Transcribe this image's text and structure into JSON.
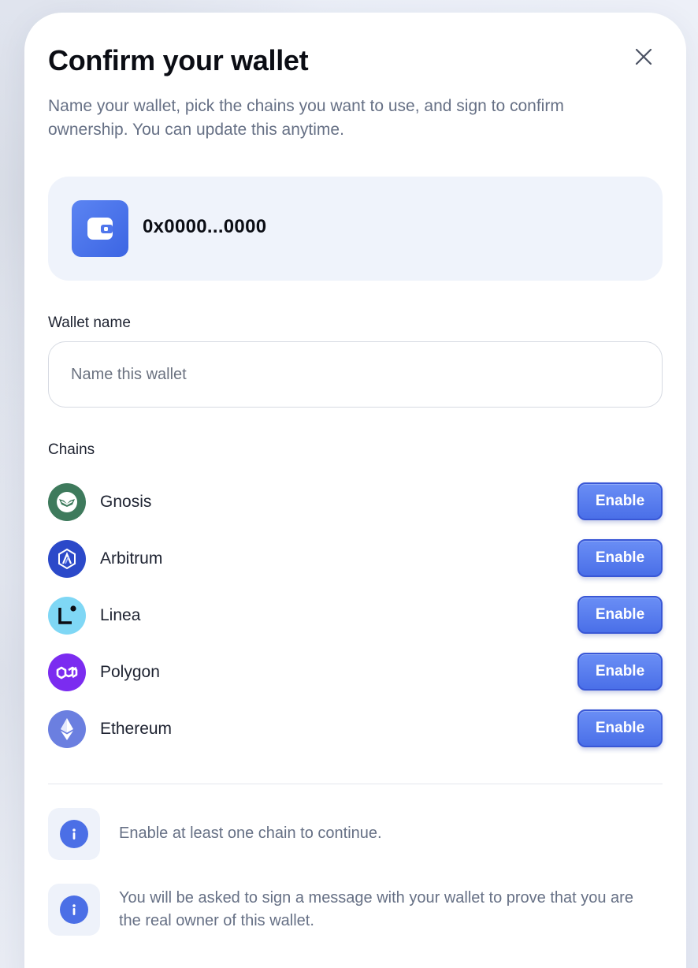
{
  "modal": {
    "title": "Confirm your wallet",
    "subtitle": "Name your wallet, pick the chains you want to use, and sign to confirm ownership. You can update this anytime.",
    "close_icon": "close-icon"
  },
  "wallet": {
    "icon": "wallet-icon",
    "address": "0x0000...0000"
  },
  "name_field": {
    "label": "Wallet name",
    "placeholder": "Name this wallet",
    "value": ""
  },
  "chains": {
    "label": "Chains",
    "items": [
      {
        "name": "Gnosis",
        "button": "Enable",
        "icon": "gnosis-icon",
        "color": "#3e7a5c"
      },
      {
        "name": "Arbitrum",
        "button": "Enable",
        "icon": "arbitrum-icon",
        "color": "#2b49c9"
      },
      {
        "name": "Linea",
        "button": "Enable",
        "icon": "linea-icon",
        "color": "#7fd7f5"
      },
      {
        "name": "Polygon",
        "button": "Enable",
        "icon": "polygon-icon",
        "color": "#7b2cf0"
      },
      {
        "name": "Ethereum",
        "button": "Enable",
        "icon": "ethereum-icon",
        "color": "#6b7fe0"
      }
    ]
  },
  "notices": [
    {
      "icon": "info-icon",
      "text": "Enable at least one chain to continue."
    },
    {
      "icon": "info-icon",
      "text": "You will be asked to sign a message with your wallet to prove that you are the real owner of this wallet."
    }
  ],
  "colors": {
    "accent": "#4a6fe8",
    "text_primary": "#0b0d14",
    "text_muted": "#667085",
    "card_bg": "#eff3fb"
  }
}
